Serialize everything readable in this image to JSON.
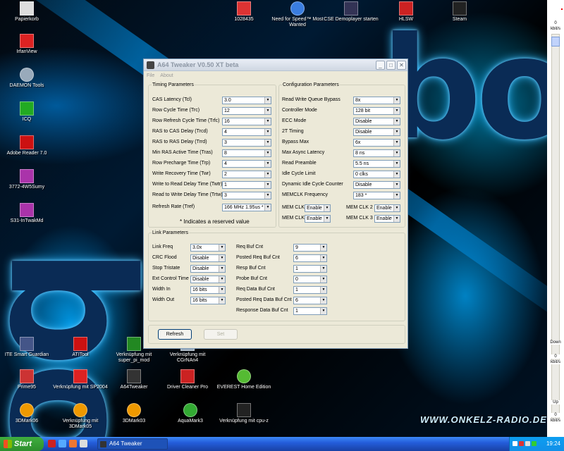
{
  "desktop": {
    "top_icons": [
      {
        "label": "1028435",
        "icon": "pdf-document-icon"
      },
      {
        "label": "Need for Speed™ Most Wanted",
        "icon": "nfs-game-icon"
      },
      {
        "label": "CSE Demoplayer starten",
        "icon": "cse-demoplayer-icon"
      },
      {
        "label": "HLSW",
        "icon": "hlsw-icon"
      },
      {
        "label": "Steam",
        "icon": "steam-icon"
      }
    ],
    "left_icons": [
      {
        "label": "Papierkorb",
        "icon": "recycle-bin-icon"
      },
      {
        "label": "IrfanView",
        "icon": "irfanview-icon"
      },
      {
        "label": "DAEMON Tools",
        "icon": "daemon-tools-icon"
      },
      {
        "label": "ICQ",
        "icon": "icq-icon"
      },
      {
        "label": "Adobe Reader 7.0",
        "icon": "adobe-reader-icon"
      },
      {
        "label": "3772-4W5Sumy",
        "icon": "archive-icon"
      },
      {
        "label": "S31-InTwakMd",
        "icon": "archive-icon"
      }
    ],
    "bottom_row1": [
      {
        "label": "ITE Smart Guardian",
        "icon": "ite-guardian-icon"
      },
      {
        "label": "ATITool",
        "icon": "atitool-icon"
      },
      {
        "label": "Verknüpfung mit super_pi_mod",
        "icon": "superpi-icon"
      },
      {
        "label": "Verknüpfung mit CGrNAn4",
        "icon": "shortcut-icon"
      }
    ],
    "bottom_row2": [
      {
        "label": "Prime95",
        "icon": "prime95-icon"
      },
      {
        "label": "Verknüpfung mit SP2004",
        "icon": "sp2004-icon"
      },
      {
        "label": "A64Tweaker",
        "icon": "a64tweaker-icon"
      },
      {
        "label": "Driver Cleaner Pro",
        "icon": "driver-cleaner-icon"
      },
      {
        "label": "EVEREST Home Edition",
        "icon": "everest-icon"
      }
    ],
    "bottom_row3": [
      {
        "label": "3DMark06",
        "icon": "3dmark-icon"
      },
      {
        "label": "Verknüpfung mit 3DMark05",
        "icon": "3dmark-icon"
      },
      {
        "label": "3DMark03",
        "icon": "3dmark-icon"
      },
      {
        "label": "AquaMark3",
        "icon": "aquamark-icon"
      },
      {
        "label": "Verknüpfung mit cpu-z",
        "icon": "cpuz-icon"
      }
    ],
    "watermark": "WWW.ONKELZ-RADIO.DE",
    "big_letters": "bo"
  },
  "window": {
    "title": "A64 Tweaker V0.50 XT beta",
    "menu": [
      "File",
      "About"
    ],
    "timing": {
      "legend": "Timing Parameters",
      "rows": [
        {
          "label": "CAS Latency (Tcl)",
          "value": "3.0"
        },
        {
          "label": "Row Cycle Time (Trc)",
          "value": "12"
        },
        {
          "label": "Row Refresh Cycle Time (Trfc)",
          "value": "16"
        },
        {
          "label": "RAS to CAS Delay (Trcd)",
          "value": "4"
        },
        {
          "label": "RAS to RAS Delay (Trrd)",
          "value": "3"
        },
        {
          "label": "Min RAS Active Time (Tras)",
          "value": "8"
        },
        {
          "label": "Row Precharge Time (Trp)",
          "value": "4"
        },
        {
          "label": "Write Recovery Time (Twr)",
          "value": "2"
        },
        {
          "label": "Write to Read Delay Time (Twtr)",
          "value": "1"
        },
        {
          "label": "Read to Write Delay Time (Trtw)",
          "value": "3"
        },
        {
          "label": "Refresh Rate (Tref)",
          "value": "166 MHz 1.95us *"
        }
      ],
      "note": "* Indicates a reserved value"
    },
    "config": {
      "legend": "Configuration Parameters",
      "rows": [
        {
          "label": "Read Write Queue Bypass",
          "value": "8x"
        },
        {
          "label": "Controller Mode",
          "value": "128 bit"
        },
        {
          "label": "ECC Mode",
          "value": "Disable"
        },
        {
          "label": "2T Timing",
          "value": "Disable"
        },
        {
          "label": "Bypass Max",
          "value": "6x"
        },
        {
          "label": "Max Async Latency",
          "value": "8 ns"
        },
        {
          "label": "Read Preamble",
          "value": "5.5 ns"
        },
        {
          "label": "Idle Cycle Limit",
          "value": "0 clks"
        },
        {
          "label": "Dynamic Idle Cycle Counter",
          "value": "Disable"
        },
        {
          "label": "MEMCLK Frequency",
          "value": "183 *"
        }
      ],
      "memclk": [
        {
          "label": "MEM CLK 0",
          "value": "Enable"
        },
        {
          "label": "MEM CLK 2",
          "value": "Enable"
        },
        {
          "label": "MEM CLK 1",
          "value": "Enable"
        },
        {
          "label": "MEM CLK 3",
          "value": "Enable"
        }
      ]
    },
    "link": {
      "legend": "Link Parameters",
      "left": [
        {
          "label": "Link Freq",
          "value": "3.0x"
        },
        {
          "label": "CRC Flood",
          "value": "Disable"
        },
        {
          "label": "Stop Tristate",
          "value": "Disable"
        },
        {
          "label": "Ext Control Time",
          "value": "Disable"
        },
        {
          "label": "Width In",
          "value": "16 bits"
        },
        {
          "label": "Width Out",
          "value": "16 bits"
        }
      ],
      "right": [
        {
          "label": "Req Buf Cnt",
          "value": "9"
        },
        {
          "label": "Posted Req Buf Cnt",
          "value": "6"
        },
        {
          "label": "Resp Buf Cnt",
          "value": "1"
        },
        {
          "label": "Probe Buf Cnt",
          "value": "0"
        },
        {
          "label": "Req Data Buf Cnt",
          "value": "1"
        },
        {
          "label": "Posted Req Data Buf Cnt",
          "value": "6"
        },
        {
          "label": "Response Data Buf Cnt",
          "value": "1"
        }
      ]
    },
    "buttons": {
      "refresh": "Refresh",
      "set": "Set"
    }
  },
  "meter": {
    "top_value": "0",
    "top_unit": "kbit/s",
    "down": "Down",
    "down_value": "0",
    "down_unit": "kbit/s",
    "up": "Up",
    "up_value": "0",
    "up_unit": "kbit/s"
  },
  "taskbar": {
    "start": "Start",
    "task": "A64 Tweaker",
    "clock": "19:24"
  },
  "colors": {
    "taskbar": "#245edb",
    "start": "#3c9e3c",
    "titlebar_inactive": "#cfd7e2",
    "window_bg": "#ece9d8"
  }
}
